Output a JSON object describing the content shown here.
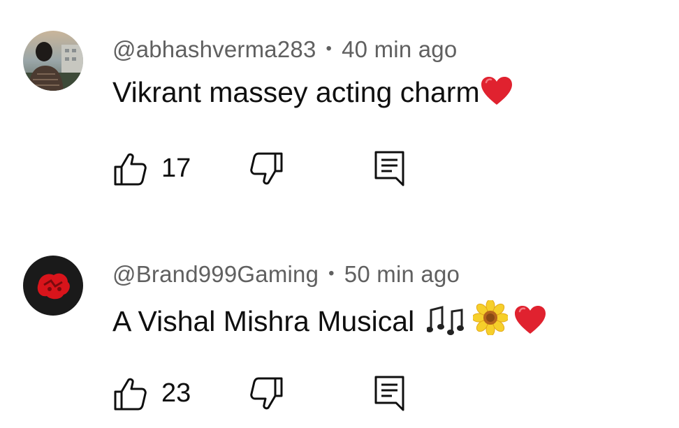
{
  "comments": [
    {
      "author": "@abhashverma283",
      "separator": "•",
      "time": "40 min ago",
      "text": "Vikrant massey acting charm",
      "emojis": [
        "red-heart"
      ],
      "likes": "17",
      "avatar": "person-photo"
    },
    {
      "author": "@Brand999Gaming",
      "separator": "•",
      "time": "50 min ago",
      "text": "A Vishal Mishra Musical ",
      "emojis": [
        "musical-notes",
        "sunflower",
        "red-heart"
      ],
      "likes": "23",
      "avatar": "red-gaming-logo"
    }
  ],
  "icons": {
    "like": "thumbs-up-icon",
    "dislike": "thumbs-down-icon",
    "reply": "reply-comment-icon"
  },
  "colors": {
    "meta_text": "#606060",
    "body_text": "#0f0f0f",
    "heart": "#e0222f",
    "avatar2_bg": "#1a1a1a",
    "avatar2_logo": "#d8141b"
  }
}
